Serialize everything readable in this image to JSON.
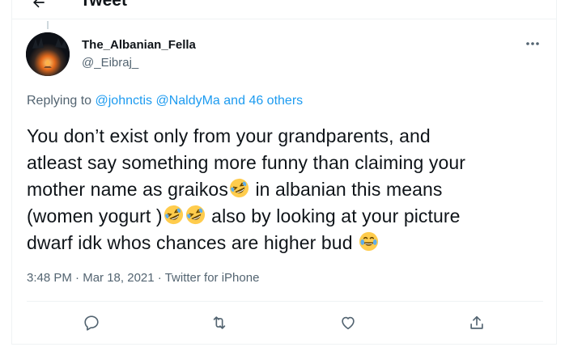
{
  "header": {
    "title": "Tweet"
  },
  "tweet": {
    "author": {
      "display_name": "The_Albanian_Fella",
      "handle": "@_Eibraj_"
    },
    "replying": {
      "prefix": "Replying to",
      "mentions": [
        "@johnctis",
        "@NaldyMa"
      ],
      "joiner": "and",
      "others": "46 others"
    },
    "text_lines": [
      [
        "You don’t exist only from your grandparents, and"
      ],
      [
        "atleast say something more funny than claiming your"
      ],
      [
        "mother name as graikos",
        "in albanian this means"
      ],
      [
        "(women yogurt )",
        "also by looking at your picture"
      ],
      [
        "dwarf idk whos chances are higher bud"
      ]
    ],
    "emojis": [
      "rofl",
      "rofl",
      "rofl",
      "joy"
    ],
    "time": "3:48 PM",
    "date": "Mar 18, 2021",
    "source": "Twitter for iPhone",
    "separator": "·"
  },
  "icons": {
    "back": "arrow-left-icon",
    "more": "more-horizontal-icon",
    "reply": "reply-icon",
    "retweet": "retweet-icon",
    "like": "like-icon",
    "share": "share-icon"
  },
  "colors": {
    "link": "#1d9bf0",
    "secondary_text": "#536471",
    "primary_text": "#0f1419",
    "border": "#eff3f4"
  }
}
